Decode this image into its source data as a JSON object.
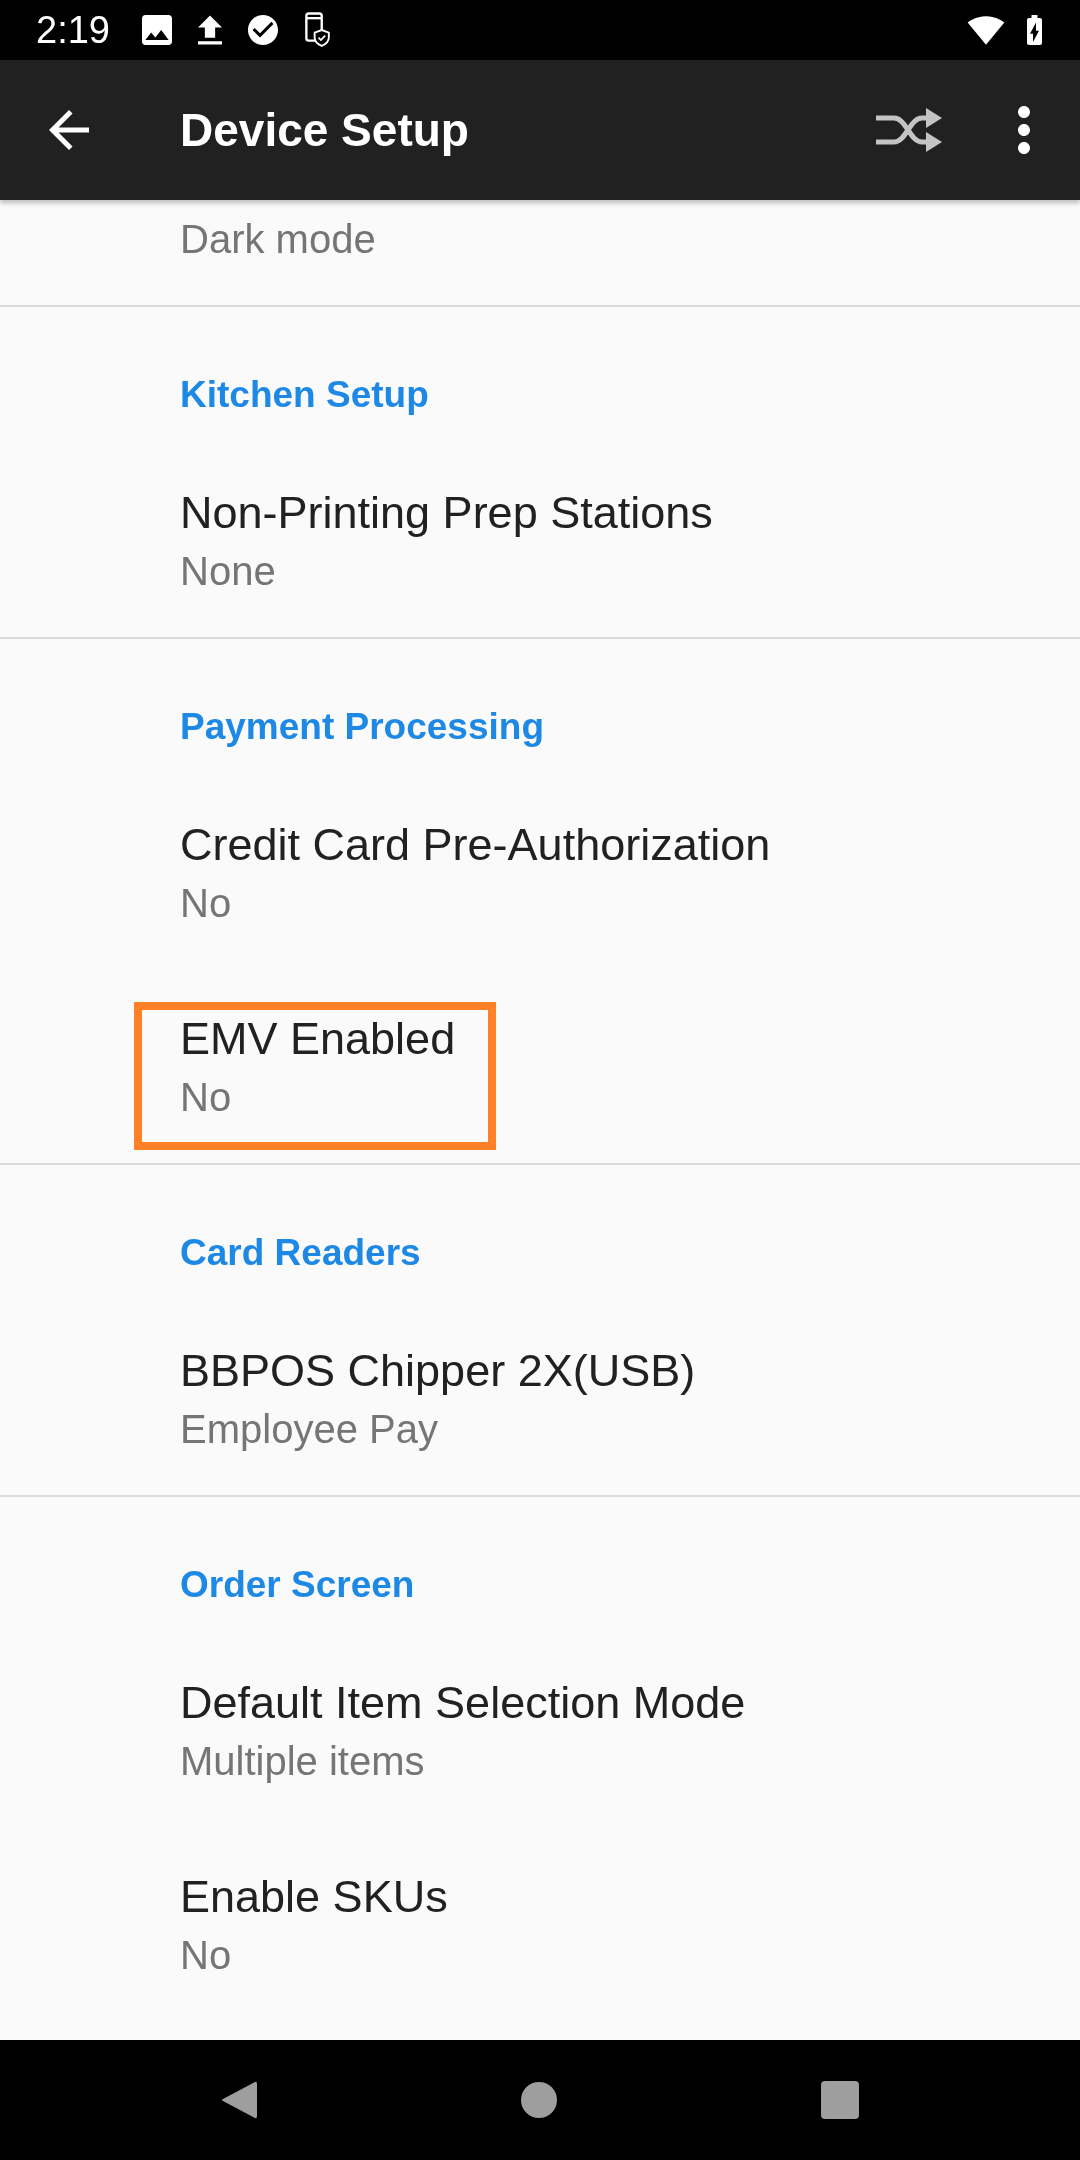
{
  "status_bar": {
    "time": "2:19"
  },
  "app_bar": {
    "title": "Device Setup"
  },
  "sections": [
    {
      "items": [
        {
          "summary": "Dark mode",
          "highlighted": false
        }
      ]
    },
    {
      "category": "Kitchen Setup",
      "items": [
        {
          "title": "Non-Printing Prep Stations",
          "summary": "None",
          "highlighted": false
        }
      ]
    },
    {
      "category": "Payment Processing",
      "items": [
        {
          "title": "Credit Card Pre-Authorization",
          "summary": "No",
          "highlighted": false
        },
        {
          "title": "EMV Enabled",
          "summary": "No",
          "highlighted": true
        }
      ]
    },
    {
      "category": "Card Readers",
      "items": [
        {
          "title": "BBPOS Chipper 2X(USB)",
          "summary": "Employee Pay",
          "highlighted": false
        }
      ]
    },
    {
      "category": "Order Screen",
      "items": [
        {
          "title": "Default Item Selection Mode",
          "summary": "Multiple items",
          "highlighted": false
        },
        {
          "title": "Enable SKUs",
          "summary": "No",
          "highlighted": false
        }
      ]
    }
  ]
}
